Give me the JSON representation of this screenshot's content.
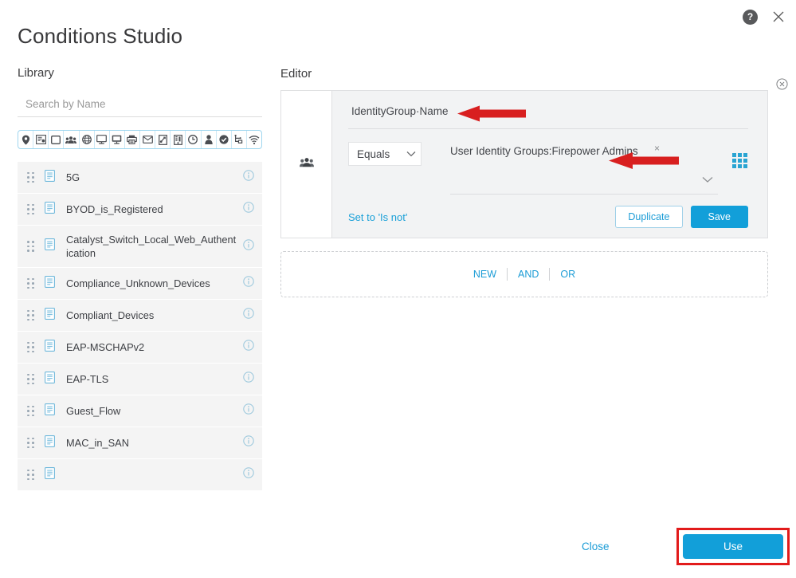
{
  "window": {
    "title": "Conditions Studio",
    "help_icon": "help-circle-icon",
    "close_icon": "close-icon"
  },
  "library": {
    "heading": "Library",
    "search": {
      "placeholder": "Search by Name",
      "value": ""
    },
    "filter_icons": [
      "location-pin-icon",
      "network-device-icon",
      "square-icon",
      "user-group-icon",
      "globe-icon",
      "desktop-icon",
      "monitor-icon",
      "printer-icon",
      "envelope-icon",
      "certificate-icon",
      "server-icon",
      "clock-icon",
      "person-icon",
      "check-circle-icon",
      "posture-icon",
      "wifi-icon"
    ],
    "items": [
      {
        "name": "5G",
        "icon": "document-icon",
        "info": "info-icon"
      },
      {
        "name": "BYOD_is_Registered",
        "icon": "document-icon",
        "info": "info-icon"
      },
      {
        "name": "Catalyst_Switch_Local_Web_Authentication",
        "icon": "document-icon",
        "info": "info-icon"
      },
      {
        "name": "Compliance_Unknown_Devices",
        "icon": "document-icon",
        "info": "info-icon"
      },
      {
        "name": "Compliant_Devices",
        "icon": "document-icon",
        "info": "info-icon"
      },
      {
        "name": "EAP-MSCHAPv2",
        "icon": "document-icon",
        "info": "info-icon"
      },
      {
        "name": "EAP-TLS",
        "icon": "document-icon",
        "info": "info-icon"
      },
      {
        "name": "Guest_Flow",
        "icon": "document-icon",
        "info": "info-icon"
      },
      {
        "name": "MAC_in_SAN",
        "icon": "document-icon",
        "info": "info-icon"
      },
      {
        "name": "",
        "icon": "document-icon",
        "info": "info-icon"
      }
    ]
  },
  "editor": {
    "heading": "Editor",
    "condition": {
      "type_icon": "user-group-icon",
      "close_icon": "close-circle-icon",
      "attribute": "IdentityGroup·Name",
      "operator": {
        "selected": "Equals",
        "chevron": "chevron-down-icon"
      },
      "value": {
        "text": "User Identity Groups:Firepower Admins",
        "remove": "×",
        "chevron": "chevron-down-icon"
      },
      "picker_icon": "grid-picker-icon",
      "is_not_link": "Set to 'Is not'",
      "duplicate_label": "Duplicate",
      "save_label": "Save"
    },
    "new_block": {
      "new_label": "NEW",
      "and_label": "AND",
      "or_label": "OR"
    }
  },
  "footer": {
    "close_label": "Close",
    "use_label": "Use"
  },
  "annotations": {
    "arrow_attribute": "red-arrow-pointing-to-attribute",
    "arrow_value": "red-arrow-pointing-to-value",
    "highlight_use": "red-box-around-use-button"
  },
  "colors": {
    "accent_blue": "#129fd9",
    "link_blue": "#1b9cd6",
    "annotation_red": "#e21b1b",
    "panel_gray": "#f2f3f4",
    "row_gray": "#f4f4f4"
  }
}
